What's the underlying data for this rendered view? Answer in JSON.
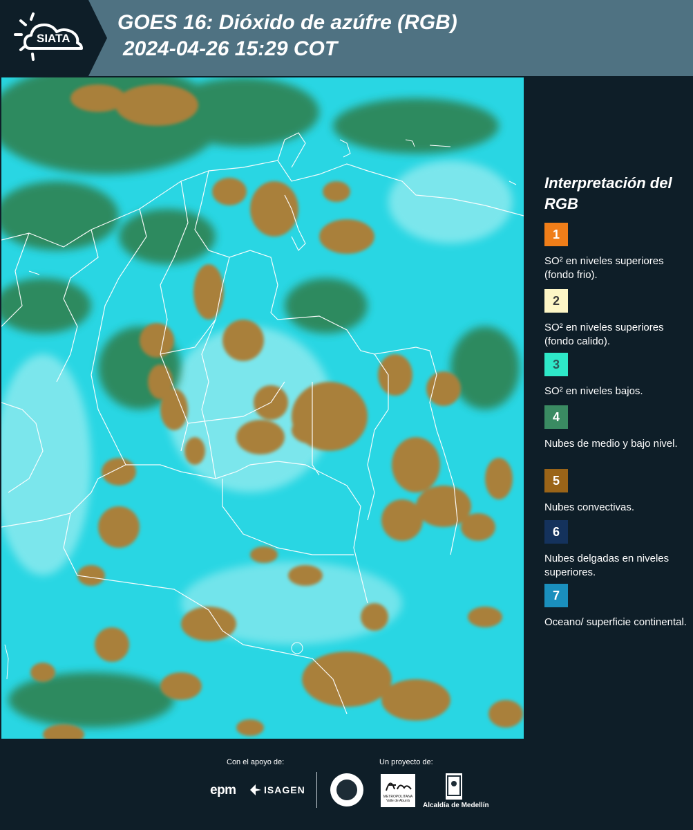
{
  "header": {
    "logo_text": "SIATA",
    "title_line1": "GOES 16: Dióxido de azúfre (RGB)",
    "title_line2": "2024-04-26 15:29 COT"
  },
  "map": {
    "description_colors": {
      "background_cyan": "#29d6e3",
      "convective_brown": "#a9803a",
      "mid_low_green": "#2f7d4a",
      "border_white": "#ffffff"
    }
  },
  "legend": {
    "title": "Interpretación del RGB",
    "items": [
      {
        "number": "1",
        "color": "#f07e19",
        "text_color": "#ffffff",
        "description": "SO² en niveles superiores (fondo frio)."
      },
      {
        "number": "2",
        "color": "#fdf6c6",
        "text_color": "#3b3b3b",
        "description": "SO² en niveles superiores (fondo calido)."
      },
      {
        "number": "3",
        "color": "#2ee8c8",
        "text_color": "#2b5a5a",
        "description": "SO² en niveles bajos."
      },
      {
        "number": "4",
        "color": "#3a8b62",
        "text_color": "#ffffff",
        "description": "Nubes de medio y bajo nivel."
      },
      {
        "number": "5",
        "color": "#9a6418",
        "text_color": "#ffffff",
        "description": "Nubes convectivas."
      },
      {
        "number": "6",
        "color": "#14325c",
        "text_color": "#ffffff",
        "description": "Nubes delgadas en niveles superiores."
      },
      {
        "number": "7",
        "color": "#1a8fbd",
        "text_color": "#ffffff",
        "description": "Oceano/ superficie continental."
      }
    ]
  },
  "footer": {
    "support_label": "Con el apoyo de:",
    "project_label": "Un proyecto de:",
    "sponsor1": "epm",
    "sponsor2": "ISAGEN",
    "org_metropolitana": "METROPOLITANA Valle de Aburrá",
    "org_alcaldia": "Alcaldía de Medellín"
  }
}
